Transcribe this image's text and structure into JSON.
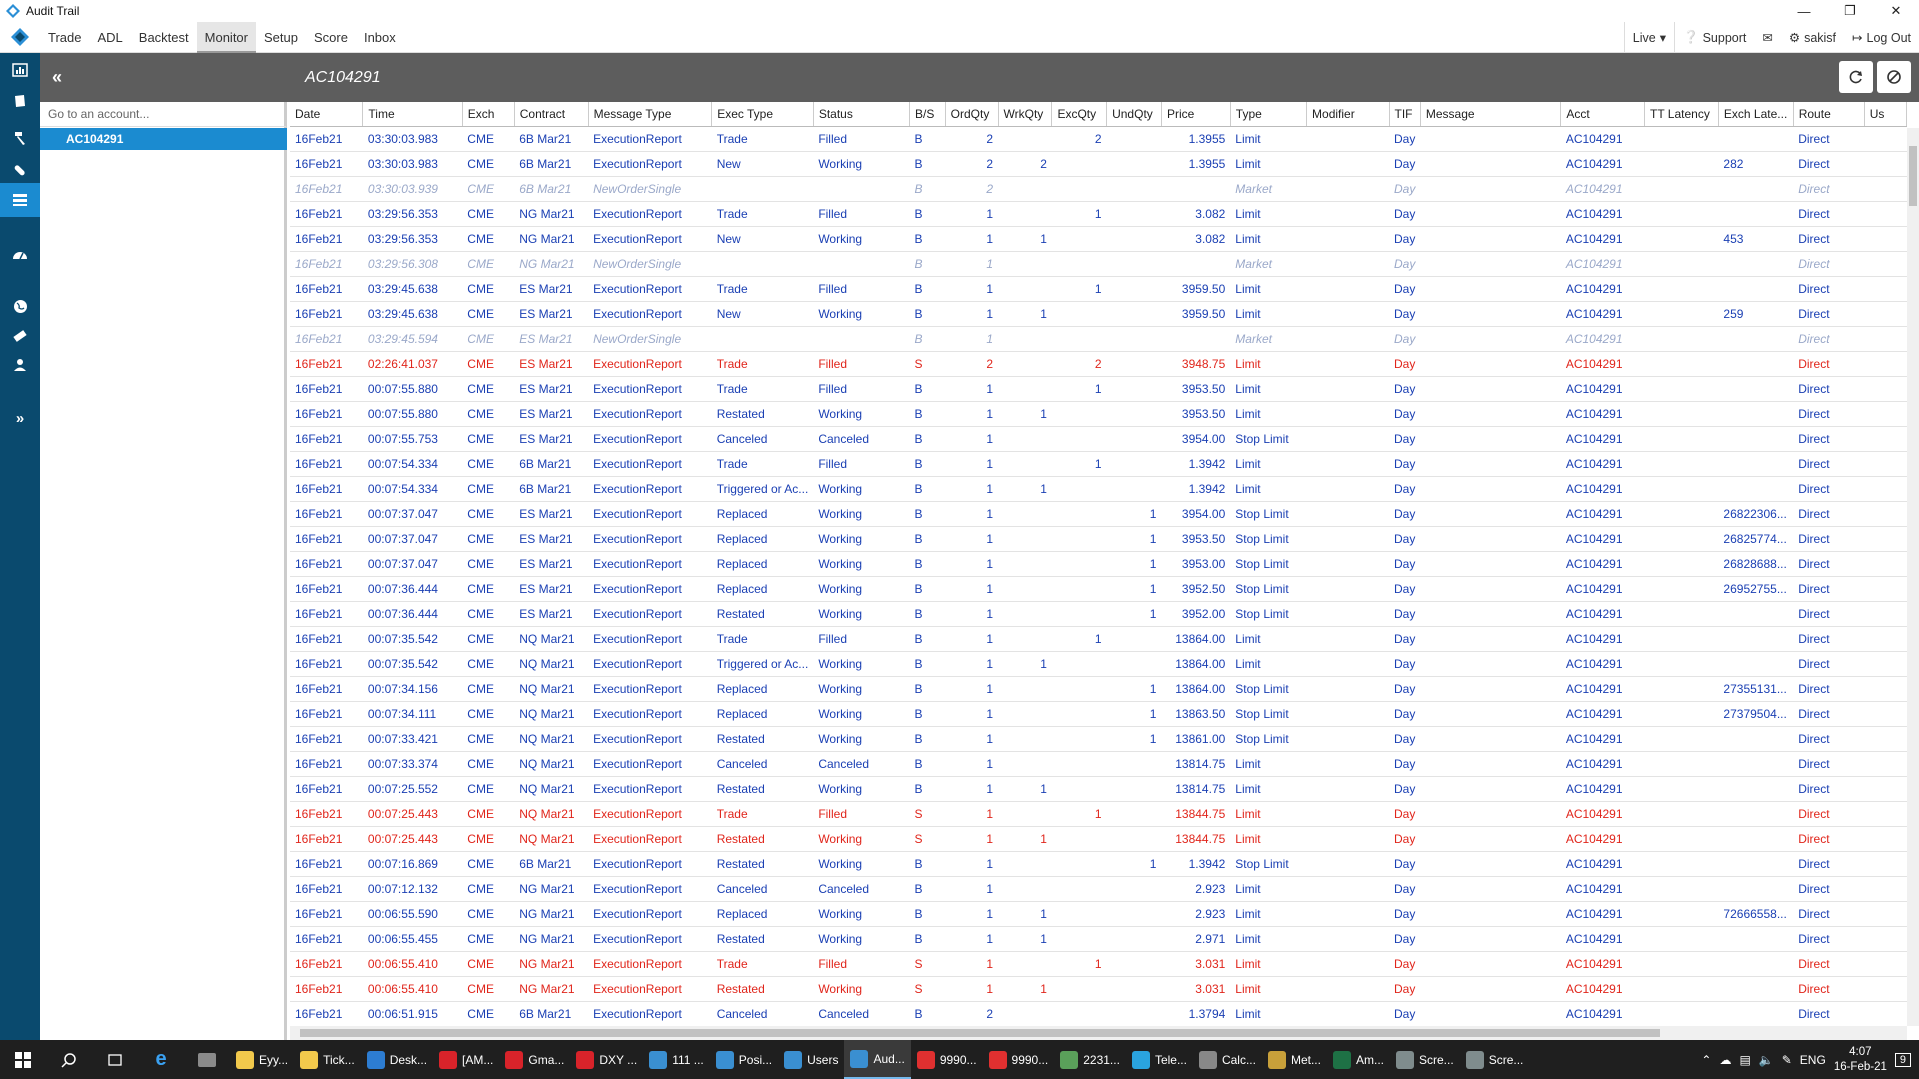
{
  "window": {
    "title": "Audit Trail"
  },
  "menu": {
    "items": [
      "Trade",
      "ADL",
      "Backtest",
      "Monitor",
      "Setup",
      "Score",
      "Inbox"
    ],
    "active": "Monitor",
    "live": "Live",
    "support": "Support",
    "user": "sakisf",
    "logout": "Log Out"
  },
  "header": {
    "account": "AC104291"
  },
  "account_panel": {
    "search_placeholder": "Go to an account...",
    "selected": "AC104291"
  },
  "table": {
    "columns": [
      "Date",
      "Time",
      "Exch",
      "Contract",
      "Message Type",
      "Exec Type",
      "Status",
      "B/S",
      "OrdQty",
      "WrkQty",
      "ExcQty",
      "UndQty",
      "Price",
      "Type",
      "Modifier",
      "TIF",
      "Message",
      "Acct",
      "TT Latency",
      "Exch Late...",
      "Route",
      "Us"
    ],
    "rows": [
      {
        "s": "b",
        "c": [
          "16Feb21",
          "03:30:03.983",
          "CME",
          "6B Mar21",
          "ExecutionReport",
          "Trade",
          "Filled",
          "B",
          "2",
          "",
          "2",
          "",
          "1.3955",
          "Limit",
          "",
          "Day",
          "",
          "AC104291",
          "",
          "",
          "Direct"
        ]
      },
      {
        "s": "b",
        "c": [
          "16Feb21",
          "03:30:03.983",
          "CME",
          "6B Mar21",
          "ExecutionReport",
          "New",
          "Working",
          "B",
          "2",
          "2",
          "",
          "",
          "1.3955",
          "Limit",
          "",
          "Day",
          "",
          "AC104291",
          "",
          "282",
          "Direct"
        ]
      },
      {
        "s": "p",
        "c": [
          "16Feb21",
          "03:30:03.939",
          "CME",
          "6B Mar21",
          "NewOrderSingle",
          "",
          "",
          "B",
          "2",
          "",
          "",
          "",
          "",
          "Market",
          "",
          "Day",
          "",
          "AC104291",
          "",
          "",
          "Direct"
        ]
      },
      {
        "s": "b",
        "c": [
          "16Feb21",
          "03:29:56.353",
          "CME",
          "NG Mar21",
          "ExecutionReport",
          "Trade",
          "Filled",
          "B",
          "1",
          "",
          "1",
          "",
          "3.082",
          "Limit",
          "",
          "Day",
          "",
          "AC104291",
          "",
          "",
          "Direct"
        ]
      },
      {
        "s": "b",
        "c": [
          "16Feb21",
          "03:29:56.353",
          "CME",
          "NG Mar21",
          "ExecutionReport",
          "New",
          "Working",
          "B",
          "1",
          "1",
          "",
          "",
          "3.082",
          "Limit",
          "",
          "Day",
          "",
          "AC104291",
          "",
          "453",
          "Direct"
        ]
      },
      {
        "s": "p",
        "c": [
          "16Feb21",
          "03:29:56.308",
          "CME",
          "NG Mar21",
          "NewOrderSingle",
          "",
          "",
          "B",
          "1",
          "",
          "",
          "",
          "",
          "Market",
          "",
          "Day",
          "",
          "AC104291",
          "",
          "",
          "Direct"
        ]
      },
      {
        "s": "b",
        "c": [
          "16Feb21",
          "03:29:45.638",
          "CME",
          "ES Mar21",
          "ExecutionReport",
          "Trade",
          "Filled",
          "B",
          "1",
          "",
          "1",
          "",
          "3959.50",
          "Limit",
          "",
          "Day",
          "",
          "AC104291",
          "",
          "",
          "Direct"
        ]
      },
      {
        "s": "b",
        "c": [
          "16Feb21",
          "03:29:45.638",
          "CME",
          "ES Mar21",
          "ExecutionReport",
          "New",
          "Working",
          "B",
          "1",
          "1",
          "",
          "",
          "3959.50",
          "Limit",
          "",
          "Day",
          "",
          "AC104291",
          "",
          "259",
          "Direct"
        ]
      },
      {
        "s": "p",
        "c": [
          "16Feb21",
          "03:29:45.594",
          "CME",
          "ES Mar21",
          "NewOrderSingle",
          "",
          "",
          "B",
          "1",
          "",
          "",
          "",
          "",
          "Market",
          "",
          "Day",
          "",
          "AC104291",
          "",
          "",
          "Direct"
        ]
      },
      {
        "s": "s",
        "c": [
          "16Feb21",
          "02:26:41.037",
          "CME",
          "ES Mar21",
          "ExecutionReport",
          "Trade",
          "Filled",
          "S",
          "2",
          "",
          "2",
          "",
          "3948.75",
          "Limit",
          "",
          "Day",
          "",
          "AC104291",
          "",
          "",
          "Direct"
        ]
      },
      {
        "s": "b",
        "c": [
          "16Feb21",
          "00:07:55.880",
          "CME",
          "ES Mar21",
          "ExecutionReport",
          "Trade",
          "Filled",
          "B",
          "1",
          "",
          "1",
          "",
          "3953.50",
          "Limit",
          "",
          "Day",
          "",
          "AC104291",
          "",
          "",
          "Direct"
        ]
      },
      {
        "s": "b",
        "c": [
          "16Feb21",
          "00:07:55.880",
          "CME",
          "ES Mar21",
          "ExecutionReport",
          "Restated",
          "Working",
          "B",
          "1",
          "1",
          "",
          "",
          "3953.50",
          "Limit",
          "",
          "Day",
          "",
          "AC104291",
          "",
          "",
          "Direct"
        ]
      },
      {
        "s": "b",
        "c": [
          "16Feb21",
          "00:07:55.753",
          "CME",
          "ES Mar21",
          "ExecutionReport",
          "Canceled",
          "Canceled",
          "B",
          "1",
          "",
          "",
          "",
          "3954.00",
          "Stop Limit",
          "",
          "Day",
          "",
          "AC104291",
          "",
          "",
          "Direct"
        ]
      },
      {
        "s": "b",
        "c": [
          "16Feb21",
          "00:07:54.334",
          "CME",
          "6B Mar21",
          "ExecutionReport",
          "Trade",
          "Filled",
          "B",
          "1",
          "",
          "1",
          "",
          "1.3942",
          "Limit",
          "",
          "Day",
          "",
          "AC104291",
          "",
          "",
          "Direct"
        ]
      },
      {
        "s": "b",
        "c": [
          "16Feb21",
          "00:07:54.334",
          "CME",
          "6B Mar21",
          "ExecutionReport",
          "Triggered or Ac...",
          "Working",
          "B",
          "1",
          "1",
          "",
          "",
          "1.3942",
          "Limit",
          "",
          "Day",
          "",
          "AC104291",
          "",
          "",
          "Direct"
        ]
      },
      {
        "s": "b",
        "c": [
          "16Feb21",
          "00:07:37.047",
          "CME",
          "ES Mar21",
          "ExecutionReport",
          "Replaced",
          "Working",
          "B",
          "1",
          "",
          "",
          "1",
          "3954.00",
          "Stop Limit",
          "",
          "Day",
          "",
          "AC104291",
          "",
          "26822306...",
          "Direct"
        ]
      },
      {
        "s": "b",
        "c": [
          "16Feb21",
          "00:07:37.047",
          "CME",
          "ES Mar21",
          "ExecutionReport",
          "Replaced",
          "Working",
          "B",
          "1",
          "",
          "",
          "1",
          "3953.50",
          "Stop Limit",
          "",
          "Day",
          "",
          "AC104291",
          "",
          "26825774...",
          "Direct"
        ]
      },
      {
        "s": "b",
        "c": [
          "16Feb21",
          "00:07:37.047",
          "CME",
          "ES Mar21",
          "ExecutionReport",
          "Replaced",
          "Working",
          "B",
          "1",
          "",
          "",
          "1",
          "3953.00",
          "Stop Limit",
          "",
          "Day",
          "",
          "AC104291",
          "",
          "26828688...",
          "Direct"
        ]
      },
      {
        "s": "b",
        "c": [
          "16Feb21",
          "00:07:36.444",
          "CME",
          "ES Mar21",
          "ExecutionReport",
          "Replaced",
          "Working",
          "B",
          "1",
          "",
          "",
          "1",
          "3952.50",
          "Stop Limit",
          "",
          "Day",
          "",
          "AC104291",
          "",
          "26952755...",
          "Direct"
        ]
      },
      {
        "s": "b",
        "c": [
          "16Feb21",
          "00:07:36.444",
          "CME",
          "ES Mar21",
          "ExecutionReport",
          "Restated",
          "Working",
          "B",
          "1",
          "",
          "",
          "1",
          "3952.00",
          "Stop Limit",
          "",
          "Day",
          "",
          "AC104291",
          "",
          "",
          "Direct"
        ]
      },
      {
        "s": "b",
        "c": [
          "16Feb21",
          "00:07:35.542",
          "CME",
          "NQ Mar21",
          "ExecutionReport",
          "Trade",
          "Filled",
          "B",
          "1",
          "",
          "1",
          "",
          "13864.00",
          "Limit",
          "",
          "Day",
          "",
          "AC104291",
          "",
          "",
          "Direct"
        ]
      },
      {
        "s": "b",
        "c": [
          "16Feb21",
          "00:07:35.542",
          "CME",
          "NQ Mar21",
          "ExecutionReport",
          "Triggered or Ac...",
          "Working",
          "B",
          "1",
          "1",
          "",
          "",
          "13864.00",
          "Limit",
          "",
          "Day",
          "",
          "AC104291",
          "",
          "",
          "Direct"
        ]
      },
      {
        "s": "b",
        "c": [
          "16Feb21",
          "00:07:34.156",
          "CME",
          "NQ Mar21",
          "ExecutionReport",
          "Replaced",
          "Working",
          "B",
          "1",
          "",
          "",
          "1",
          "13864.00",
          "Stop Limit",
          "",
          "Day",
          "",
          "AC104291",
          "",
          "27355131...",
          "Direct"
        ]
      },
      {
        "s": "b",
        "c": [
          "16Feb21",
          "00:07:34.111",
          "CME",
          "NQ Mar21",
          "ExecutionReport",
          "Replaced",
          "Working",
          "B",
          "1",
          "",
          "",
          "1",
          "13863.50",
          "Stop Limit",
          "",
          "Day",
          "",
          "AC104291",
          "",
          "27379504...",
          "Direct"
        ]
      },
      {
        "s": "b",
        "c": [
          "16Feb21",
          "00:07:33.421",
          "CME",
          "NQ Mar21",
          "ExecutionReport",
          "Restated",
          "Working",
          "B",
          "1",
          "",
          "",
          "1",
          "13861.00",
          "Stop Limit",
          "",
          "Day",
          "",
          "AC104291",
          "",
          "",
          "Direct"
        ]
      },
      {
        "s": "b",
        "c": [
          "16Feb21",
          "00:07:33.374",
          "CME",
          "NQ Mar21",
          "ExecutionReport",
          "Canceled",
          "Canceled",
          "B",
          "1",
          "",
          "",
          "",
          "13814.75",
          "Limit",
          "",
          "Day",
          "",
          "AC104291",
          "",
          "",
          "Direct"
        ]
      },
      {
        "s": "b",
        "c": [
          "16Feb21",
          "00:07:25.552",
          "CME",
          "NQ Mar21",
          "ExecutionReport",
          "Restated",
          "Working",
          "B",
          "1",
          "1",
          "",
          "",
          "13814.75",
          "Limit",
          "",
          "Day",
          "",
          "AC104291",
          "",
          "",
          "Direct"
        ]
      },
      {
        "s": "s",
        "c": [
          "16Feb21",
          "00:07:25.443",
          "CME",
          "NQ Mar21",
          "ExecutionReport",
          "Trade",
          "Filled",
          "S",
          "1",
          "",
          "1",
          "",
          "13844.75",
          "Limit",
          "",
          "Day",
          "",
          "AC104291",
          "",
          "",
          "Direct"
        ]
      },
      {
        "s": "s",
        "c": [
          "16Feb21",
          "00:07:25.443",
          "CME",
          "NQ Mar21",
          "ExecutionReport",
          "Restated",
          "Working",
          "S",
          "1",
          "1",
          "",
          "",
          "13844.75",
          "Limit",
          "",
          "Day",
          "",
          "AC104291",
          "",
          "",
          "Direct"
        ]
      },
      {
        "s": "b",
        "c": [
          "16Feb21",
          "00:07:16.869",
          "CME",
          "6B Mar21",
          "ExecutionReport",
          "Restated",
          "Working",
          "B",
          "1",
          "",
          "",
          "1",
          "1.3942",
          "Stop Limit",
          "",
          "Day",
          "",
          "AC104291",
          "",
          "",
          "Direct"
        ]
      },
      {
        "s": "b",
        "c": [
          "16Feb21",
          "00:07:12.132",
          "CME",
          "NG Mar21",
          "ExecutionReport",
          "Canceled",
          "Canceled",
          "B",
          "1",
          "",
          "",
          "",
          "2.923",
          "Limit",
          "",
          "Day",
          "",
          "AC104291",
          "",
          "",
          "Direct"
        ]
      },
      {
        "s": "b",
        "c": [
          "16Feb21",
          "00:06:55.590",
          "CME",
          "NG Mar21",
          "ExecutionReport",
          "Replaced",
          "Working",
          "B",
          "1",
          "1",
          "",
          "",
          "2.923",
          "Limit",
          "",
          "Day",
          "",
          "AC104291",
          "",
          "72666558...",
          "Direct"
        ]
      },
      {
        "s": "b",
        "c": [
          "16Feb21",
          "00:06:55.455",
          "CME",
          "NG Mar21",
          "ExecutionReport",
          "Restated",
          "Working",
          "B",
          "1",
          "1",
          "",
          "",
          "2.971",
          "Limit",
          "",
          "Day",
          "",
          "AC104291",
          "",
          "",
          "Direct"
        ]
      },
      {
        "s": "s",
        "c": [
          "16Feb21",
          "00:06:55.410",
          "CME",
          "NG Mar21",
          "ExecutionReport",
          "Trade",
          "Filled",
          "S",
          "1",
          "",
          "1",
          "",
          "3.031",
          "Limit",
          "",
          "Day",
          "",
          "AC104291",
          "",
          "",
          "Direct"
        ]
      },
      {
        "s": "s",
        "c": [
          "16Feb21",
          "00:06:55.410",
          "CME",
          "NG Mar21",
          "ExecutionReport",
          "Restated",
          "Working",
          "S",
          "1",
          "1",
          "",
          "",
          "3.031",
          "Limit",
          "",
          "Day",
          "",
          "AC104291",
          "",
          "",
          "Direct"
        ]
      },
      {
        "s": "b",
        "c": [
          "16Feb21",
          "00:06:51.915",
          "CME",
          "6B Mar21",
          "ExecutionReport",
          "Canceled",
          "Canceled",
          "B",
          "2",
          "",
          "",
          "",
          "1.3794",
          "Limit",
          "",
          "Day",
          "",
          "AC104291",
          "",
          "",
          "Direct"
        ]
      }
    ]
  },
  "taskbar": {
    "apps": [
      {
        "label": "Eyy...",
        "icon": "folder-icon",
        "color": "#f2c94c"
      },
      {
        "label": "Tick...",
        "icon": "folder-icon",
        "color": "#f2c94c"
      },
      {
        "label": "Desk...",
        "icon": "desktop-icon",
        "color": "#2d7dd2"
      },
      {
        "label": "[AM...",
        "icon": "opera-icon",
        "color": "#d8232a"
      },
      {
        "label": "Gma...",
        "icon": "opera-icon",
        "color": "#d8232a"
      },
      {
        "label": "DXY ...",
        "icon": "opera-icon",
        "color": "#d8232a"
      },
      {
        "label": "111 ...",
        "icon": "tt-icon",
        "color": "#3a8fd1"
      },
      {
        "label": "Posi...",
        "icon": "tt-icon",
        "color": "#3a8fd1"
      },
      {
        "label": "Users",
        "icon": "tt-icon",
        "color": "#3a8fd1"
      },
      {
        "label": "Aud...",
        "icon": "tt-icon",
        "color": "#3a8fd1",
        "active": true
      },
      {
        "label": "9990...",
        "icon": "red-app-icon",
        "color": "#e03030"
      },
      {
        "label": "9990...",
        "icon": "red-app-icon",
        "color": "#e03030"
      },
      {
        "label": "2231...",
        "icon": "chart-app-icon",
        "color": "#5aa05a"
      },
      {
        "label": "Tele...",
        "icon": "telegram-icon",
        "color": "#2aa3de"
      },
      {
        "label": "Calc...",
        "icon": "calculator-icon",
        "color": "#888888"
      },
      {
        "label": "Met...",
        "icon": "metatrader-icon",
        "color": "#c8a03a"
      },
      {
        "label": "Am...",
        "icon": "excel-icon",
        "color": "#1e7145"
      },
      {
        "label": "Scre...",
        "icon": "snip-icon",
        "color": "#7f8c8d"
      },
      {
        "label": "Scre...",
        "icon": "snip-icon",
        "color": "#7f8c8d"
      }
    ],
    "lang": "ENG",
    "time": "4:07",
    "date": "16-Feb-21",
    "notif_count": "9"
  }
}
